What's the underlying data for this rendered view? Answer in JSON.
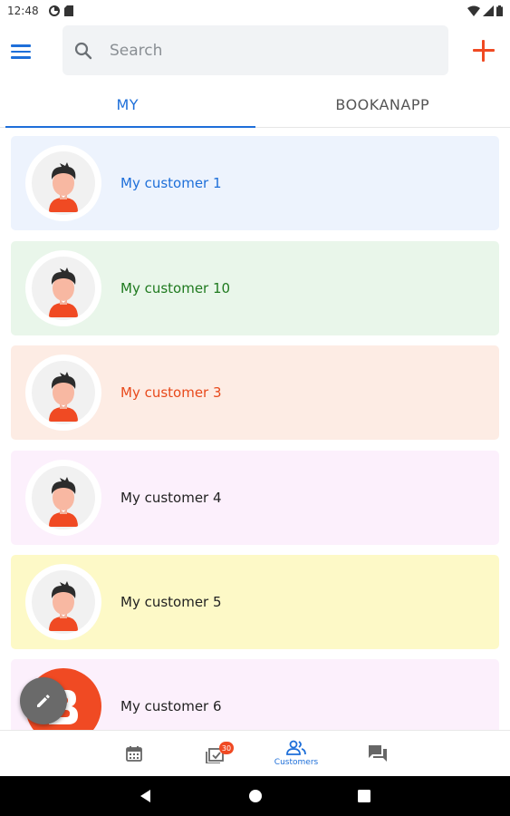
{
  "status_bar": {
    "time": "12:48"
  },
  "search": {
    "placeholder": "Search"
  },
  "tabs": [
    {
      "label": "MY",
      "active": true
    },
    {
      "label": "BOOKANAPP",
      "active": false
    }
  ],
  "customers": [
    {
      "name": "My customer 1",
      "bg": "#edf3fd",
      "text_color": "#1e6fd9",
      "avatar": "person"
    },
    {
      "name": "My customer 10",
      "bg": "#e9f6ea",
      "text_color": "#1f7a1f",
      "avatar": "person"
    },
    {
      "name": "My customer 3",
      "bg": "#fdece4",
      "text_color": "#e84a1c",
      "avatar": "person"
    },
    {
      "name": "My customer 4",
      "bg": "#fcf0fc",
      "text_color": "#222222",
      "avatar": "person"
    },
    {
      "name": "My customer 5",
      "bg": "#fdf9c7",
      "text_color": "#222222",
      "avatar": "person"
    },
    {
      "name": "My customer 6",
      "bg": "#fcf0fc",
      "text_color": "#222222",
      "avatar": "brand-logo"
    }
  ],
  "bottom_nav": {
    "items": [
      {
        "icon": "calendar-icon"
      },
      {
        "icon": "appointments-icon",
        "badge": "30"
      },
      {
        "icon": "customers-icon",
        "label": "Customers",
        "active": true
      },
      {
        "icon": "chat-icon"
      }
    ]
  },
  "colors": {
    "accent": "#1e6fd9",
    "brand": "#f04a23"
  }
}
